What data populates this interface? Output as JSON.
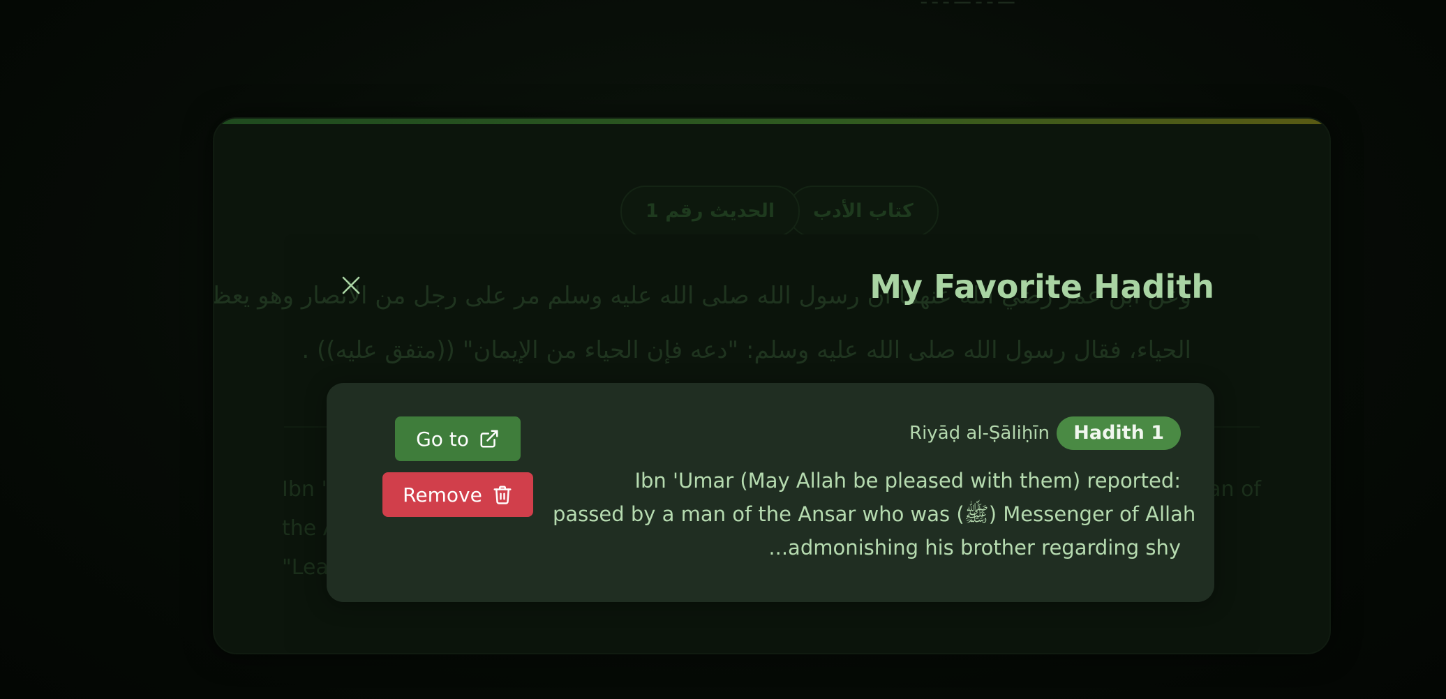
{
  "background": {
    "top_strip_text": "ـــ ـ ـ ـــ ـ ـ ـ",
    "chips": {
      "book": "كتاب الأدب",
      "number": "الحديث رقم 1"
    },
    "arabic_lines": [
      "وعن ابن عمر رضي الله عنهما أن رسول الله صلى الله عليه وسلم مر على رجل من الأنصار وهو يعظ أخاه في",
      "الحياء، فقال رسول الله صلى الله عليه وسلم: \"دعه فإن الحياء من الإيمان\" ((متفق عليه)) ."
    ],
    "english_left": [
      "Ibn 'U",
      "the A",
      "\"Lea"
    ],
    "english_right": "an of"
  },
  "modal": {
    "title": "My Favorite Hadith",
    "close_icon": "close-icon",
    "favorite": {
      "badge": "Hadith 1",
      "book": "Riyāḍ al-Ṣāliḥīn",
      "text_lines": [
        "Ibn 'Umar (May Allah be pleased with them) reported:",
        "passed by a man of the Ansar who was (ﷺ) Messenger of Allah",
        "...admonishing his brother regarding shy"
      ],
      "goto_label": "Go to",
      "goto_icon": "external-link-icon",
      "remove_label": "Remove",
      "remove_icon": "trash-icon"
    }
  },
  "colors": {
    "title": "#a9d4a3",
    "card": "#202e22",
    "go_button": "#3f7d3b",
    "remove_button": "#d13f4b",
    "badge": "#4a8a44"
  }
}
